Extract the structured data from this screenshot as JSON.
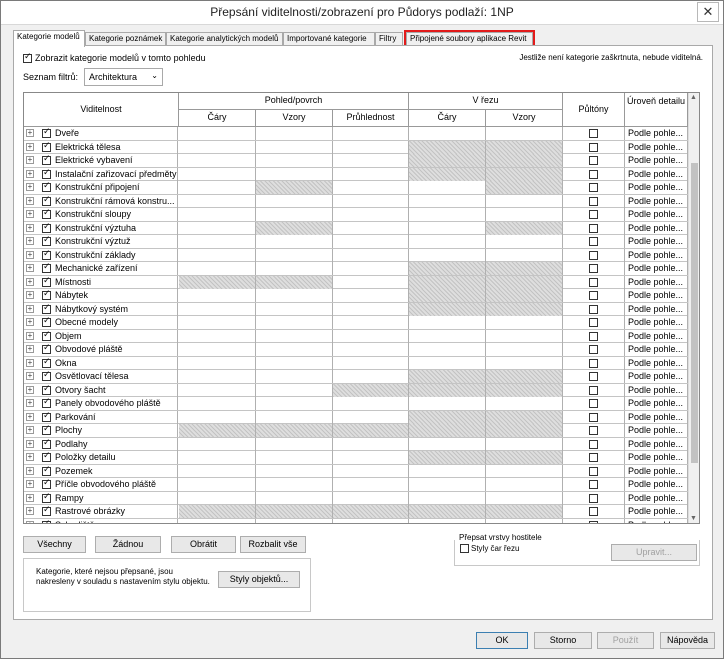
{
  "window": {
    "title": "Přepsání viditelnosti/zobrazení pro Půdorys podlaží: 1NP",
    "close_glyph": "✕"
  },
  "tabs": [
    {
      "label": "Kategorie modelů"
    },
    {
      "label": "Kategorie poznámek"
    },
    {
      "label": "Kategorie analytických modelů"
    },
    {
      "label": "Importované kategorie"
    },
    {
      "label": "Filtry"
    },
    {
      "label": "Připojené soubory aplikace Revit"
    }
  ],
  "panel": {
    "show_label": "Zobrazit kategorie modelů v tomto pohledu",
    "note": "Jestliže není kategorie zaškrtnuta, nebude viditelná.",
    "filter_label": "Seznam filtrů:",
    "filter_value": "Architektura"
  },
  "grid_headers": {
    "visibility": "Viditelnost",
    "projection_surface": "Pohled/povrch",
    "cut": "V řezu",
    "lines": "Čáry",
    "patterns": "Vzory",
    "transparency": "Průhlednost",
    "cut_lines": "Čáry",
    "cut_patterns": "Vzory",
    "halftone": "Půltóny",
    "detail_level": "Úroveň detailu"
  },
  "detail_value": "Podle pohle...",
  "rows": [
    {
      "name": "Dveře",
      "hatch": []
    },
    {
      "name": "Elektrická tělesa",
      "hatch": [
        3,
        4
      ]
    },
    {
      "name": "Elektrické vybavení",
      "hatch": [
        3,
        4
      ]
    },
    {
      "name": "Instalační zařizovací předměty",
      "hatch": [
        3,
        4
      ]
    },
    {
      "name": "Konstrukční připojení",
      "hatch": [
        1,
        4
      ]
    },
    {
      "name": "Konstrukční rámová konstru...",
      "hatch": []
    },
    {
      "name": "Konstrukční sloupy",
      "hatch": []
    },
    {
      "name": "Konstrukční výztuha",
      "hatch": [
        1,
        4
      ]
    },
    {
      "name": "Konstrukční výztuž",
      "hatch": []
    },
    {
      "name": "Konstrukční základy",
      "hatch": []
    },
    {
      "name": "Mechanické zařízení",
      "hatch": [
        3,
        4
      ]
    },
    {
      "name": "Místnosti",
      "hatch": [
        0,
        1,
        3,
        4
      ]
    },
    {
      "name": "Nábytek",
      "hatch": [
        3,
        4
      ]
    },
    {
      "name": "Nábytkový systém",
      "hatch": [
        3,
        4
      ]
    },
    {
      "name": "Obecné modely",
      "hatch": []
    },
    {
      "name": "Objem",
      "hatch": []
    },
    {
      "name": "Obvodové pláště",
      "hatch": []
    },
    {
      "name": "Okna",
      "hatch": []
    },
    {
      "name": "Osvětlovací tělesa",
      "hatch": [
        3,
        4
      ]
    },
    {
      "name": "Otvory šacht",
      "hatch": [
        2,
        3,
        4
      ]
    },
    {
      "name": "Panely obvodového pláště",
      "hatch": []
    },
    {
      "name": "Parkování",
      "hatch": [
        3,
        4
      ]
    },
    {
      "name": "Plochy",
      "hatch": [
        0,
        1,
        2,
        3,
        4
      ]
    },
    {
      "name": "Podlahy",
      "hatch": []
    },
    {
      "name": "Položky detailu",
      "hatch": [
        3,
        4
      ]
    },
    {
      "name": "Pozemek",
      "hatch": []
    },
    {
      "name": "Příčle obvodového pláště",
      "hatch": []
    },
    {
      "name": "Rampy",
      "hatch": []
    },
    {
      "name": "Rastrové obrázky",
      "hatch": [
        0,
        1,
        2,
        3,
        4
      ]
    },
    {
      "name": "Schodiště",
      "hatch": []
    }
  ],
  "buttons": {
    "all": "Všechny",
    "none": "Žádnou",
    "invert": "Obrátit",
    "expand": "Rozbalit vše",
    "object_styles": "Styly objektů...",
    "edit": "Upravit...",
    "ok": "OK",
    "cancel": "Storno",
    "apply": "Použít",
    "help": "Nápověda"
  },
  "info_text": "Kategorie, které nejsou přepsané, jsou nakresleny v souladu s nastavením stylu objektu.",
  "host_layers": {
    "title": "Přepsat vrstvy hostitele",
    "cut_line_styles": "Styly čar řezu"
  },
  "colors": {
    "highlight": "#e21b1b",
    "hatch": "#c3c3c3",
    "ok_border": "#3c7fb1"
  },
  "icons": {
    "expand": "plus-box-icon",
    "checkbox": "checkbox-checked-icon",
    "close": "close-icon",
    "dropdown": "chevron-down-icon"
  }
}
